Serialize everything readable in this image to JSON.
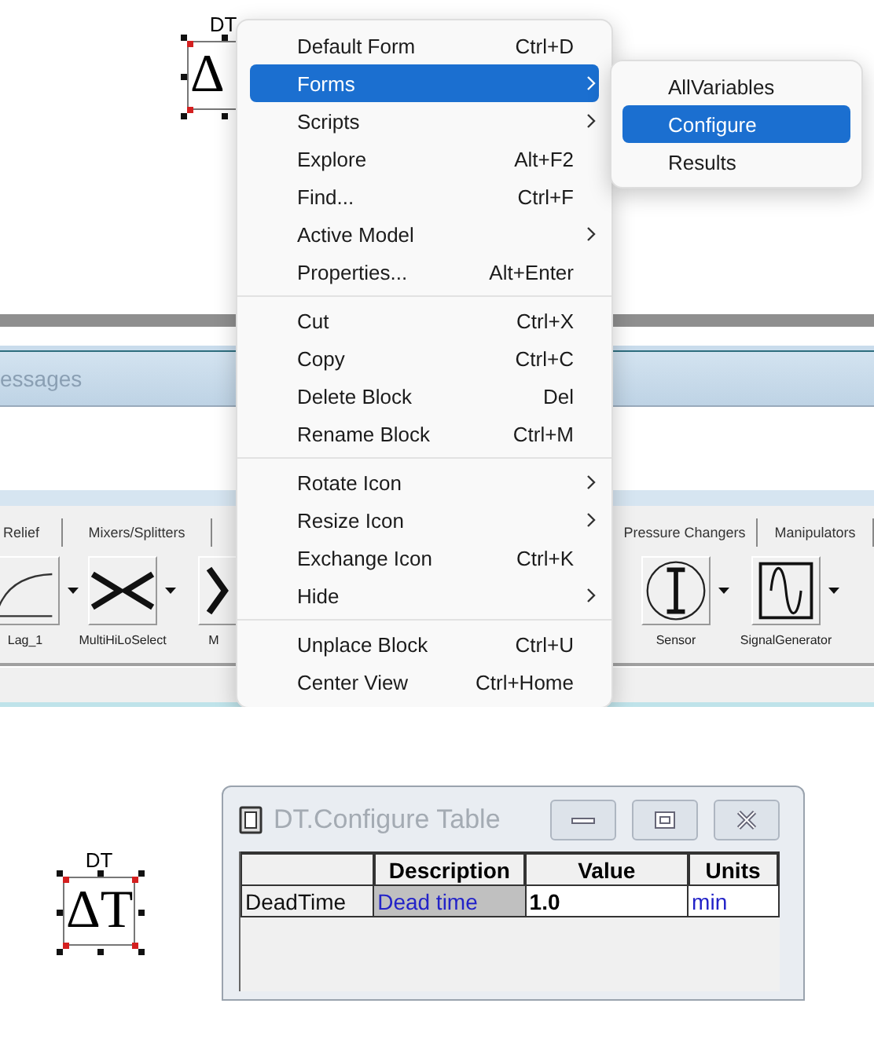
{
  "diagram_block_top": {
    "label": "DT",
    "symbol": "Δ",
    "selected": true
  },
  "messages_panel": {
    "title": "essages"
  },
  "palette": {
    "tabs": [
      {
        "label": "Relief"
      },
      {
        "label": "Mixers/Splitters"
      },
      {
        "label": "Pressure Changers"
      },
      {
        "label": "Manipulators"
      }
    ],
    "items": [
      {
        "kind": "lag",
        "label": "Lag_1",
        "dropdown": true
      },
      {
        "kind": "hilo",
        "label": "MultiHiLoSelect",
        "dropdown": true
      },
      {
        "kind": "chevron",
        "label": "M",
        "dropdown": false
      },
      {
        "kind": "sensor",
        "label": "Sensor",
        "dropdown": true
      },
      {
        "kind": "signal",
        "label": "SignalGenerator",
        "dropdown": true
      }
    ]
  },
  "context_menu": {
    "items": [
      {
        "kind": "item",
        "label": "Default Form",
        "shortcut": "Ctrl+D",
        "submenu": false,
        "selected": false
      },
      {
        "kind": "item",
        "label": "Forms",
        "submenu": true,
        "selected": true
      },
      {
        "kind": "item",
        "label": "Scripts",
        "submenu": true,
        "selected": false
      },
      {
        "kind": "item",
        "label": "Explore",
        "shortcut": "Alt+F2",
        "submenu": false,
        "selected": false
      },
      {
        "kind": "item",
        "label": "Find...",
        "shortcut": "Ctrl+F",
        "submenu": false,
        "selected": false
      },
      {
        "kind": "item",
        "label": "Active Model",
        "submenu": true,
        "selected": false
      },
      {
        "kind": "item",
        "label": "Properties...",
        "shortcut": "Alt+Enter",
        "submenu": false,
        "selected": false
      },
      {
        "kind": "separator"
      },
      {
        "kind": "item",
        "label": "Cut",
        "shortcut": "Ctrl+X",
        "submenu": false,
        "selected": false
      },
      {
        "kind": "item",
        "label": "Copy",
        "shortcut": "Ctrl+C",
        "submenu": false,
        "selected": false
      },
      {
        "kind": "item",
        "label": "Delete Block",
        "shortcut": "Del",
        "submenu": false,
        "selected": false
      },
      {
        "kind": "item",
        "label": "Rename Block",
        "shortcut": "Ctrl+M",
        "submenu": false,
        "selected": false
      },
      {
        "kind": "separator"
      },
      {
        "kind": "item",
        "label": "Rotate Icon",
        "submenu": true,
        "selected": false
      },
      {
        "kind": "item",
        "label": "Resize Icon",
        "submenu": true,
        "selected": false
      },
      {
        "kind": "item",
        "label": "Exchange Icon",
        "shortcut": "Ctrl+K",
        "submenu": false,
        "selected": false
      },
      {
        "kind": "item",
        "label": "Hide",
        "submenu": true,
        "selected": false
      },
      {
        "kind": "separator"
      },
      {
        "kind": "item",
        "label": "Unplace Block",
        "shortcut": "Ctrl+U",
        "submenu": false,
        "selected": false
      },
      {
        "kind": "item",
        "label": "Center View",
        "shortcut": "Ctrl+Home",
        "submenu": false,
        "selected": false
      }
    ]
  },
  "submenu": {
    "items": [
      {
        "label": "AllVariables",
        "selected": false
      },
      {
        "label": "Configure",
        "selected": true
      },
      {
        "label": "Results",
        "selected": false
      }
    ]
  },
  "diagram_block_bottom": {
    "label": "DT",
    "symbol": "ΔT",
    "selected": true
  },
  "dialog": {
    "title": "DT.Configure Table",
    "active": false,
    "columns": [
      "",
      "Description",
      "Value",
      "Units"
    ],
    "rows": [
      {
        "cells": [
          "DeadTime",
          "Dead time",
          "1.0",
          "min"
        ]
      }
    ]
  }
}
